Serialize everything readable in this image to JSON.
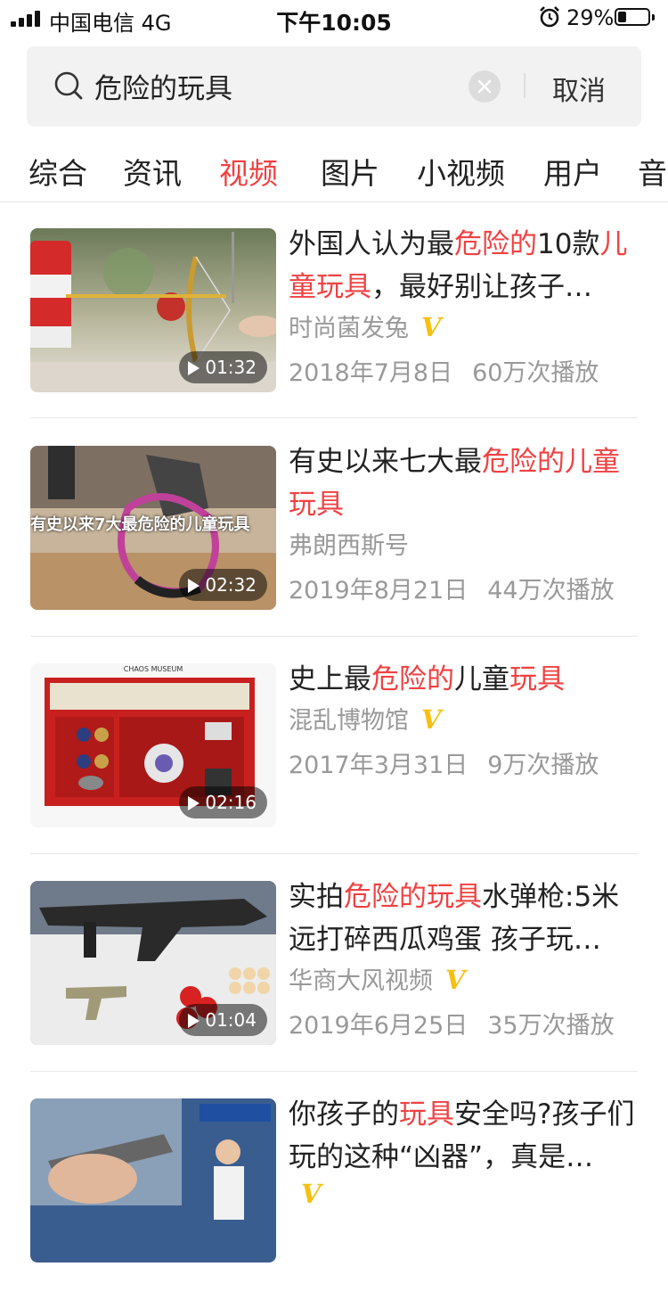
{
  "status_bar": {
    "carrier": "中国电信   4G",
    "time": "下午10:05",
    "battery": "29%",
    "battery_level": 0.29
  },
  "search": {
    "query": "危险的玩具",
    "cancel_label": "取消"
  },
  "tabs": [
    {
      "label": "综合",
      "active": false
    },
    {
      "label": "资讯",
      "active": false
    },
    {
      "label": "视频",
      "active": true
    },
    {
      "label": "图片",
      "active": false
    },
    {
      "label": "小视频",
      "active": false
    },
    {
      "label": "用户",
      "active": false
    },
    {
      "label": "音",
      "active": false
    }
  ],
  "colors": {
    "accent": "#f04142",
    "verified": "#f5c00f",
    "muted": "#999999"
  },
  "videos": [
    {
      "title_parts": [
        {
          "t": "外国人认为最",
          "hl": false
        },
        {
          "t": "危险的",
          "hl": true
        },
        {
          "t": "10款",
          "hl": false
        },
        {
          "t": "儿童玩具",
          "hl": true
        },
        {
          "t": "，最好别让孩子…",
          "hl": false
        }
      ],
      "author": "时尚菌发兔",
      "verified": true,
      "date": "2018年7月8日",
      "plays": "60万次播放",
      "duration": "01:32"
    },
    {
      "title_parts": [
        {
          "t": "有史以来七大最",
          "hl": false
        },
        {
          "t": "危险的儿童玩具",
          "hl": true
        }
      ],
      "author": "弗朗西斯号",
      "verified": false,
      "date": "2019年8月21日",
      "plays": "44万次播放",
      "duration": "02:32",
      "overlay": "有史以来7大最危险的儿童玩具"
    },
    {
      "title_parts": [
        {
          "t": "史上最",
          "hl": false
        },
        {
          "t": "危险的",
          "hl": true
        },
        {
          "t": "儿童",
          "hl": false
        },
        {
          "t": "玩具",
          "hl": true
        }
      ],
      "author": "混乱博物馆",
      "verified": true,
      "date": "2017年3月31日",
      "plays": "9万次播放",
      "duration": "02:16",
      "thumb_caption": "CHAOS MUSEUM"
    },
    {
      "title_parts": [
        {
          "t": "实拍",
          "hl": false
        },
        {
          "t": "危险的玩具",
          "hl": true
        },
        {
          "t": "水弹枪:5米远打碎西瓜鸡蛋 孩子玩…",
          "hl": false
        }
      ],
      "author": "华商大风视频",
      "verified": true,
      "date": "2019年6月25日",
      "plays": "35万次播放",
      "duration": "01:04"
    },
    {
      "title_parts": [
        {
          "t": "你孩子的",
          "hl": false
        },
        {
          "t": "玩具",
          "hl": true
        },
        {
          "t": "安全吗?孩子们玩的这种“凶器”，真是…",
          "hl": false
        }
      ],
      "author": "",
      "verified": true,
      "date": "",
      "plays": "",
      "duration": ""
    }
  ]
}
